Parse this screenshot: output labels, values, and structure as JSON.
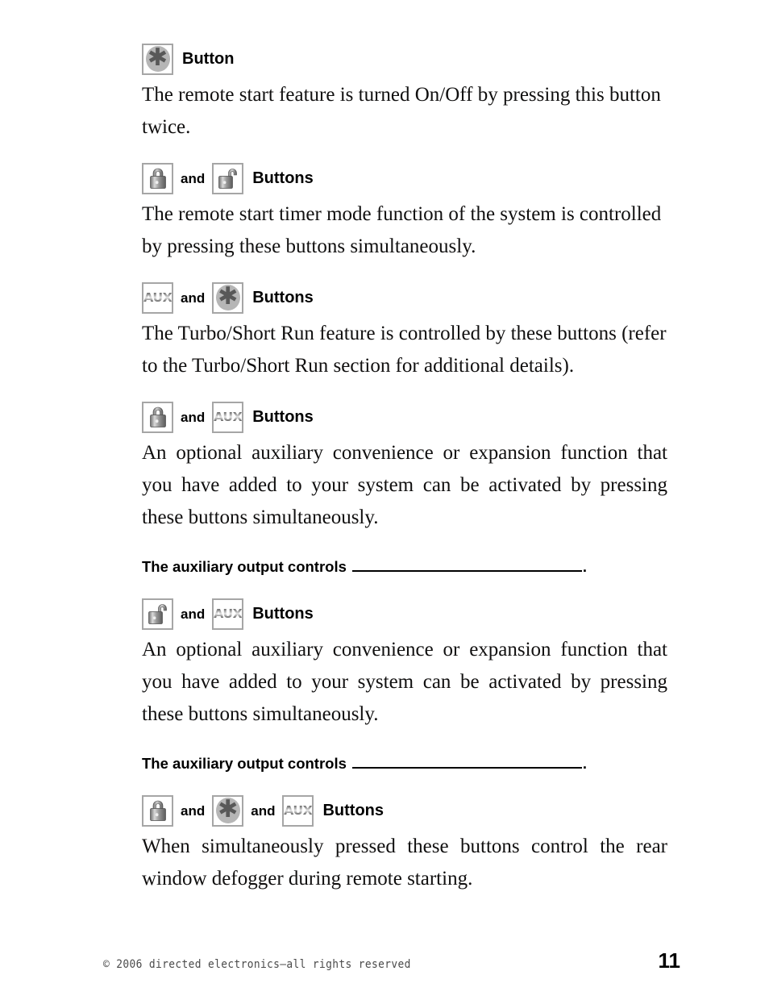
{
  "page": {
    "number": "11",
    "copyright": "© 2006 directed electronics—all rights reserved"
  },
  "sections": [
    {
      "id": "star-button",
      "icons": [
        {
          "type": "asterisk",
          "label": "asterisk-button-icon"
        }
      ],
      "conjunctions": [],
      "heading_word": "Button",
      "body": "The remote start feature is turned On/Off by pressing this button twice."
    },
    {
      "id": "lock-unlock-buttons",
      "icons": [
        {
          "type": "lock",
          "label": "lock-button-icon"
        },
        {
          "type": "unlock",
          "label": "unlock-button-icon"
        }
      ],
      "conjunctions": [
        "and"
      ],
      "heading_word": "Buttons",
      "body": "The remote start timer mode function of the system is controlled by pressing these buttons simultaneously."
    },
    {
      "id": "aux-star-buttons",
      "icons": [
        {
          "type": "aux",
          "label": "aux-button-icon"
        },
        {
          "type": "asterisk",
          "label": "asterisk-button-icon"
        }
      ],
      "conjunctions": [
        "and"
      ],
      "heading_word": "Buttons",
      "body": "The Turbo/Short Run feature is controlled by these buttons (refer to the Turbo/Short Run section for additional details)."
    },
    {
      "id": "lock-aux-buttons",
      "icons": [
        {
          "type": "lock",
          "label": "lock-button-icon"
        },
        {
          "type": "aux",
          "label": "aux-button-icon"
        }
      ],
      "conjunctions": [
        "and"
      ],
      "heading_word": "Buttons",
      "body": "An optional auxiliary convenience or expansion function that you have added to your system can be activated by pressing these buttons simultaneously."
    },
    {
      "id": "unlock-aux-buttons",
      "icons": [
        {
          "type": "unlock",
          "label": "unlock-button-icon"
        },
        {
          "type": "aux",
          "label": "aux-button-icon"
        }
      ],
      "conjunctions": [
        "and"
      ],
      "heading_word": "Buttons",
      "body": "An optional auxiliary convenience or expansion function that you have added to your system can be activated by pressing these buttons simultaneously."
    },
    {
      "id": "lock-star-aux-buttons",
      "icons": [
        {
          "type": "lock",
          "label": "lock-button-icon"
        },
        {
          "type": "asterisk",
          "label": "asterisk-button-icon"
        },
        {
          "type": "aux",
          "label": "aux-button-icon"
        }
      ],
      "conjunctions": [
        "and",
        "and"
      ],
      "heading_word": "Buttons",
      "body": "When simultaneously pressed these buttons control the rear window defogger during remote starting."
    }
  ],
  "fill_in_headings": [
    {
      "id": "aux-output-controls-1",
      "text": "The auxiliary output controls",
      "trailing": "."
    },
    {
      "id": "aux-output-controls-2",
      "text": "The auxiliary output controls",
      "trailing": "."
    }
  ],
  "labels": {
    "conjunction": "and",
    "aux_glyph": "AUX",
    "asterisk_glyph": "✱"
  },
  "colors": {
    "text": "#100f0f",
    "icon_border": "#a6a6a6",
    "asterisk_disc": "#b6b6b6",
    "asterisk_mark": "#585858",
    "footer_text": "#4a4a4a"
  }
}
